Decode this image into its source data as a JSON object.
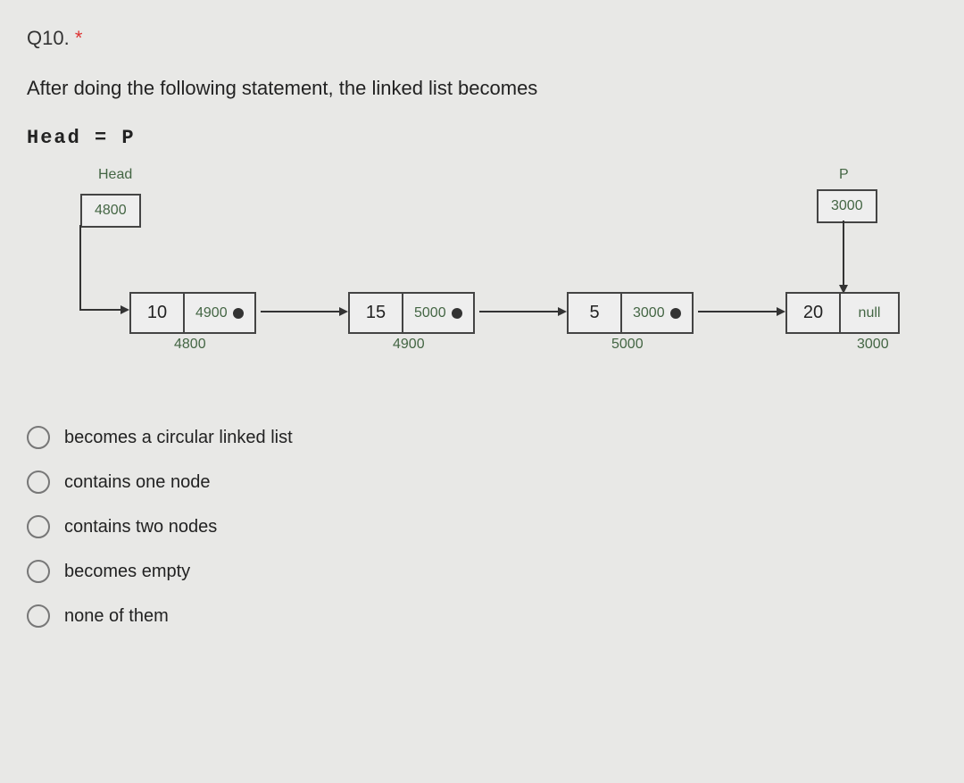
{
  "question": {
    "number": "Q10.",
    "asterisk": "*",
    "text": "After doing the following statement, the linked list becomes",
    "code": "Head = P"
  },
  "diagram": {
    "head_label": "Head",
    "head_value": "4800",
    "p_label": "P",
    "p_value": "3000",
    "nodes": [
      {
        "data": "10",
        "next": "4900",
        "addr": "4800",
        "null": false
      },
      {
        "data": "15",
        "next": "5000",
        "addr": "4900",
        "null": false
      },
      {
        "data": "5",
        "next": "3000",
        "addr": "5000",
        "null": false
      },
      {
        "data": "20",
        "next": "null",
        "addr": "3000",
        "null": true
      }
    ]
  },
  "options": [
    "becomes a circular linked list",
    "contains one node",
    "contains two nodes",
    "becomes empty",
    "none of them"
  ]
}
